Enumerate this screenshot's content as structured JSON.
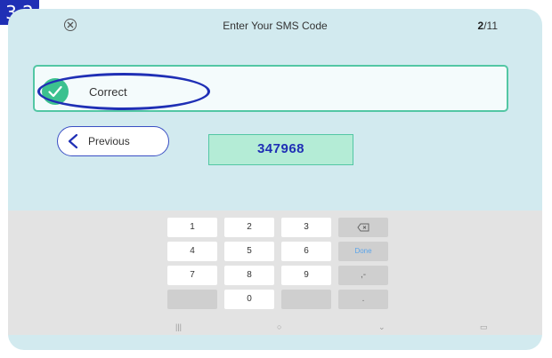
{
  "step": {
    "label": "3.2"
  },
  "header": {
    "title": "Enter Your SMS Code",
    "progress_current": "2",
    "progress_total": "/11"
  },
  "result": {
    "label": "Correct"
  },
  "nav": {
    "previous_label": "Previous"
  },
  "code": {
    "value": "347968"
  },
  "keyboard": {
    "rows": [
      [
        "1",
        "2",
        "3",
        "backspace-icon"
      ],
      [
        "4",
        "5",
        "6",
        "Done"
      ],
      [
        "7",
        "8",
        "9",
        ",-"
      ],
      [
        "",
        "0",
        "",
        "."
      ]
    ],
    "done_label": "Done",
    "punct_label": ",-",
    "dot_label": "."
  },
  "colors": {
    "accent": "#1f2fb5",
    "panel_bg": "#d2eaef",
    "success": "#3cc18f",
    "code_bg": "#b4ecd6",
    "keyboard_bg": "#e3e3e3"
  },
  "android_nav": [
    "recents-icon",
    "home-icon",
    "back-icon",
    "keyboard-hide-icon"
  ]
}
